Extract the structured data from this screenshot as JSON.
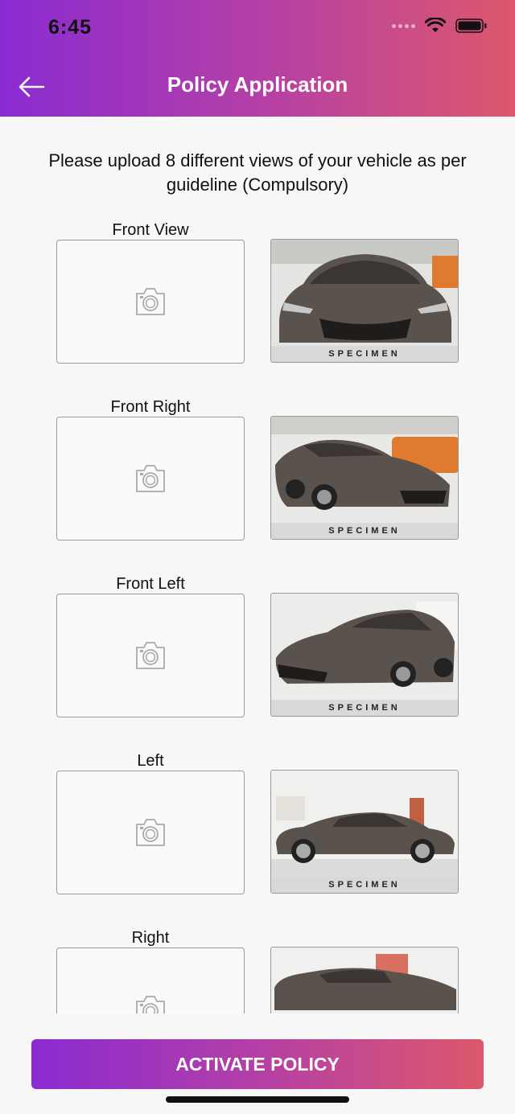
{
  "status_bar": {
    "time": "6:45"
  },
  "header": {
    "title": "Policy Application",
    "back_icon": "arrow-left-icon"
  },
  "instructions": "Please upload 8 different views of your vehicle as per guideline (Compulsory)",
  "views": [
    {
      "label": "Front View",
      "specimen_text": "SPECIMEN"
    },
    {
      "label": "Front Right",
      "specimen_text": "SPECIMEN"
    },
    {
      "label": "Front Left",
      "specimen_text": "SPECIMEN"
    },
    {
      "label": "Left",
      "specimen_text": "SPECIMEN"
    },
    {
      "label": "Right",
      "specimen_text": ""
    }
  ],
  "action": {
    "activate_label": "ACTIVATE POLICY"
  },
  "colors": {
    "gradient_start": "#8a2bd2",
    "gradient_end": "#dc586b",
    "car_body": "#5a524d"
  }
}
